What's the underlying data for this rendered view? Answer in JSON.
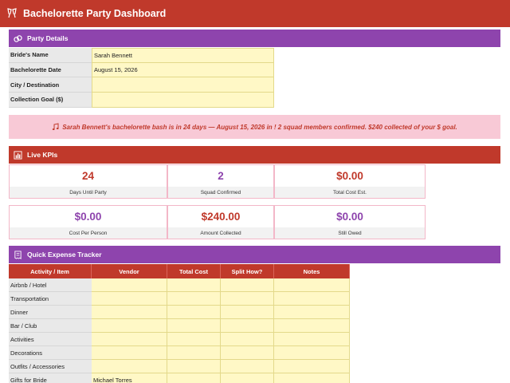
{
  "header": {
    "title": "Bachelorette Party Dashboard",
    "icon": "champagne-glasses-icon"
  },
  "party_details": {
    "title": "Party Details",
    "icon": "rings-icon",
    "fields": [
      {
        "label": "Bride's Name",
        "value": "Sarah Bennett"
      },
      {
        "label": "Bachelorette Date",
        "value": "August 15, 2026"
      },
      {
        "label": "City / Destination",
        "value": ""
      },
      {
        "label": "Collection Goal ($)",
        "value": ""
      }
    ]
  },
  "countdown": {
    "icon": "music-note-icon",
    "message": "Sarah Bennett's bachelorette bash is in 24 days — August 15, 2026 in !  2 squad members confirmed.  $240 collected of your $ goal."
  },
  "kpis": {
    "title": "Live KPIs",
    "icon": "bar-chart-icon",
    "row1": [
      {
        "value": "24",
        "caption": "Days Until Party",
        "color": "#c0392b"
      },
      {
        "value": "2",
        "caption": "Squad Confirmed",
        "color": "#8e44ad"
      },
      {
        "value": "$0.00",
        "caption": "Total Cost Est.",
        "color": "#c0392b"
      }
    ],
    "row2": [
      {
        "value": "$0.00",
        "caption": "Cost Per Person",
        "color": "#8e44ad"
      },
      {
        "value": "$240.00",
        "caption": "Amount Collected",
        "color": "#c0392b"
      },
      {
        "value": "$0.00",
        "caption": "Still Owed",
        "color": "#8e44ad"
      }
    ]
  },
  "expense_tracker": {
    "title": "Quick Expense Tracker",
    "icon": "receipt-icon",
    "columns": [
      "Activity / Item",
      "Vendor",
      "Total Cost",
      "Split How?",
      "Notes"
    ],
    "rows": [
      [
        "Airbnb / Hotel",
        "",
        "",
        "",
        ""
      ],
      [
        "Transportation",
        "",
        "",
        "",
        ""
      ],
      [
        "Dinner",
        "",
        "",
        "",
        ""
      ],
      [
        "Bar / Club",
        "",
        "",
        "",
        ""
      ],
      [
        "Activities",
        "",
        "",
        "",
        ""
      ],
      [
        "Decorations",
        "",
        "",
        "",
        ""
      ],
      [
        "Outfits / Accessories",
        "",
        "",
        "",
        ""
      ],
      [
        "Gifts for Bride",
        "Michael Torres",
        "",
        "",
        ""
      ]
    ]
  },
  "colors": {
    "primary_red": "#c0392b",
    "primary_purple": "#8e44ad",
    "input_yellow": "#fff8c6",
    "banner_pink": "#f8c9d6"
  }
}
